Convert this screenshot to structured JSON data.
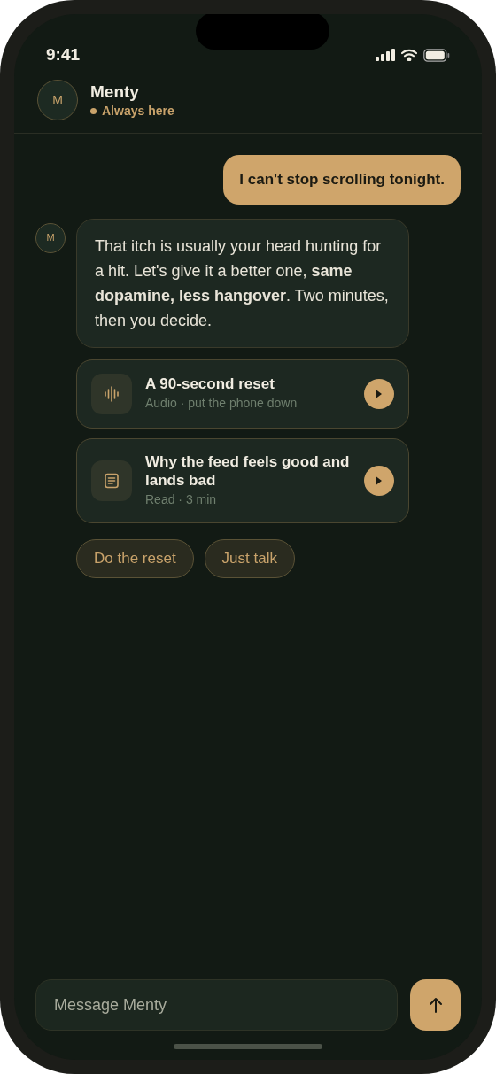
{
  "status_bar": {
    "time": "9:41"
  },
  "header": {
    "avatar": "M",
    "name": "Menty",
    "status": "Always here",
    "online": true
  },
  "messages": [
    {
      "kind": "user",
      "text": "I can't stop scrolling tonight."
    },
    {
      "kind": "bot",
      "avatar": "M",
      "text": "That itch is usually your head hunting for a hit. Let's give it a better one, **same dopamine, less hangover**. Two minutes, then you decide."
    }
  ],
  "cards": [
    {
      "kind": "audio",
      "title": "A 90-second reset",
      "subtitle": "Audio · put the phone down"
    },
    {
      "kind": "read",
      "title": "Why the feed feels good and lands bad",
      "subtitle": "Read · 3 min"
    }
  ],
  "quick_replies": [
    "Do the reset",
    "Just talk"
  ],
  "composer": {
    "placeholder": "Message Menty"
  }
}
